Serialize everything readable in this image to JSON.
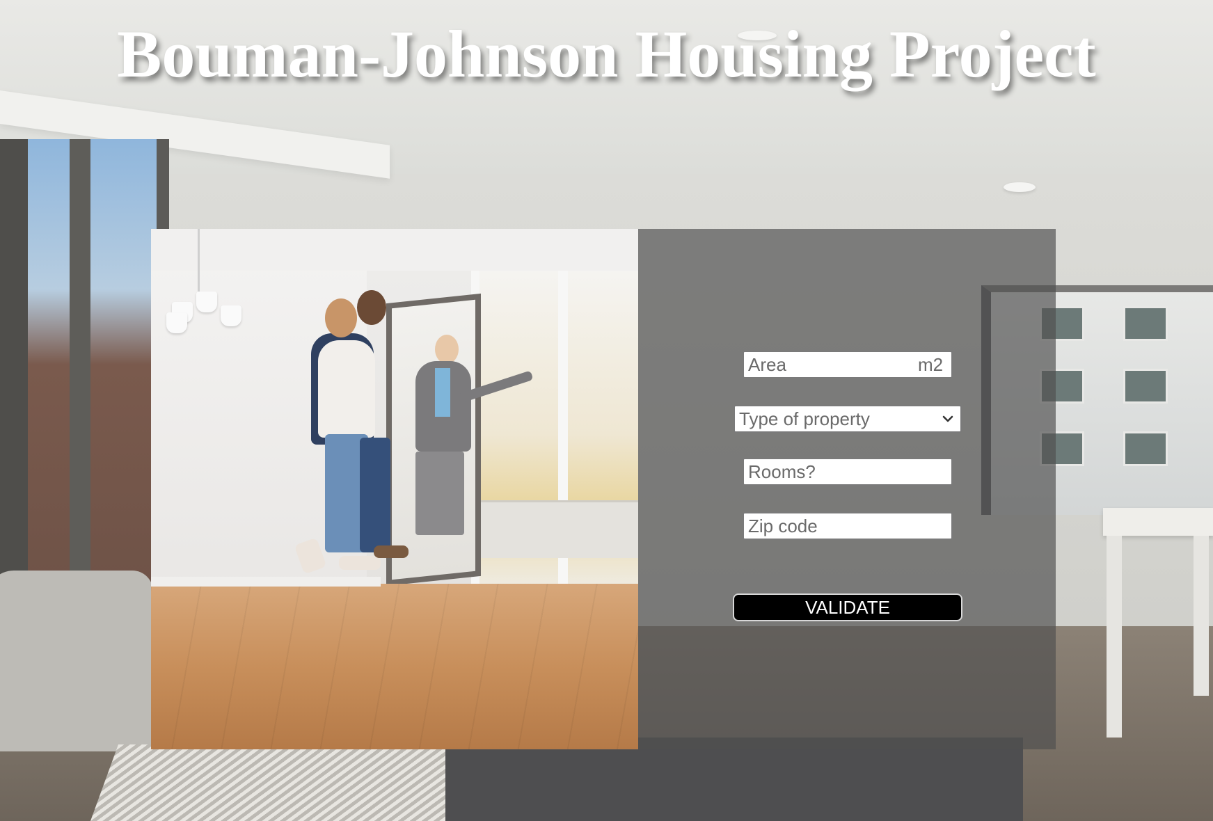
{
  "header": {
    "title": "Bouman-Johnson Housing Project"
  },
  "photo": {
    "description_icon": "agent-showing-apartment-photo"
  },
  "form": {
    "area": {
      "placeholder": "Area",
      "value": "",
      "unit": "m2"
    },
    "property_type": {
      "selected": "Type of property"
    },
    "rooms": {
      "placeholder": "Rooms?",
      "value": ""
    },
    "zip": {
      "placeholder": "Zip code",
      "value": ""
    },
    "validate_label": "VALIDATE"
  },
  "colors": {
    "panel_overlay": "#505050",
    "button_bg": "#000000",
    "button_text": "#ffffff",
    "title_text": "#ffffff"
  }
}
